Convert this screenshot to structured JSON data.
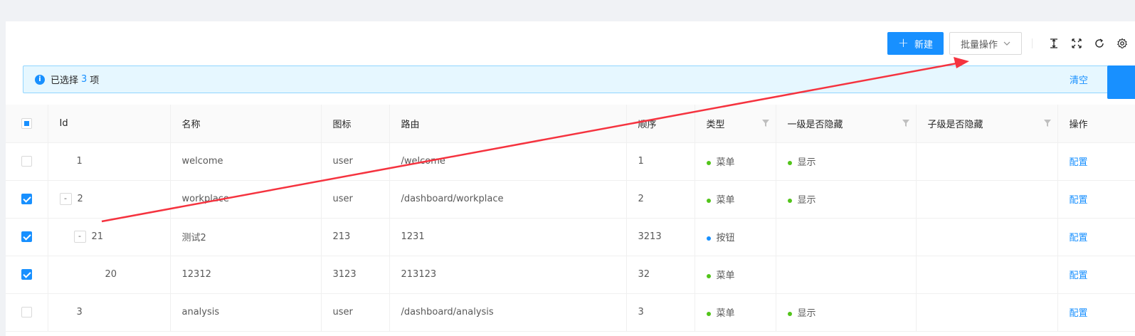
{
  "toolbar": {
    "new_label": "新建",
    "batch_label": "批量操作"
  },
  "alert": {
    "prefix": "已选择",
    "count": "3",
    "suffix": "项",
    "clear_label": "清空"
  },
  "table": {
    "headers": [
      "Id",
      "名称",
      "图标",
      "路由",
      "顺序",
      "类型",
      "一级是否隐藏",
      "子级是否隐藏",
      "操作"
    ],
    "rows": [
      {
        "checked": false,
        "id": "1",
        "name": "welcome",
        "icon": "user",
        "route": "/welcome",
        "order": "1",
        "type": "菜单",
        "type_color": "#52c41a",
        "hide1": "显示",
        "hide2": "",
        "action": "配置"
      },
      {
        "checked": true,
        "id": "2",
        "expander": "-",
        "name": "workplace",
        "icon": "user",
        "route": "/dashboard/workplace",
        "order": "2",
        "type": "菜单",
        "type_color": "#52c41a",
        "hide1": "显示",
        "hide2": "",
        "action": "配置"
      },
      {
        "checked": true,
        "id": "21",
        "expander": "-",
        "name": "测试2",
        "icon": "213",
        "route": "1231",
        "order": "3213",
        "type": "按钮",
        "type_color": "#1890ff",
        "hide1": "",
        "hide2": "",
        "action": "配置"
      },
      {
        "checked": true,
        "id": "20",
        "name": "12312",
        "icon": "3123",
        "route": "213123",
        "order": "32",
        "type": "菜单",
        "type_color": "#52c41a",
        "hide1": "",
        "hide2": "",
        "action": "配置"
      },
      {
        "checked": false,
        "id": "3",
        "name": "analysis",
        "icon": "user",
        "route": "/dashboard/analysis",
        "order": "3",
        "type": "菜单",
        "type_color": "#52c41a",
        "hide1": "显示",
        "hide2": "",
        "action": "配置"
      }
    ]
  },
  "colors": {
    "primary": "#1890ff",
    "annotation_arrow": "#f5333f"
  }
}
